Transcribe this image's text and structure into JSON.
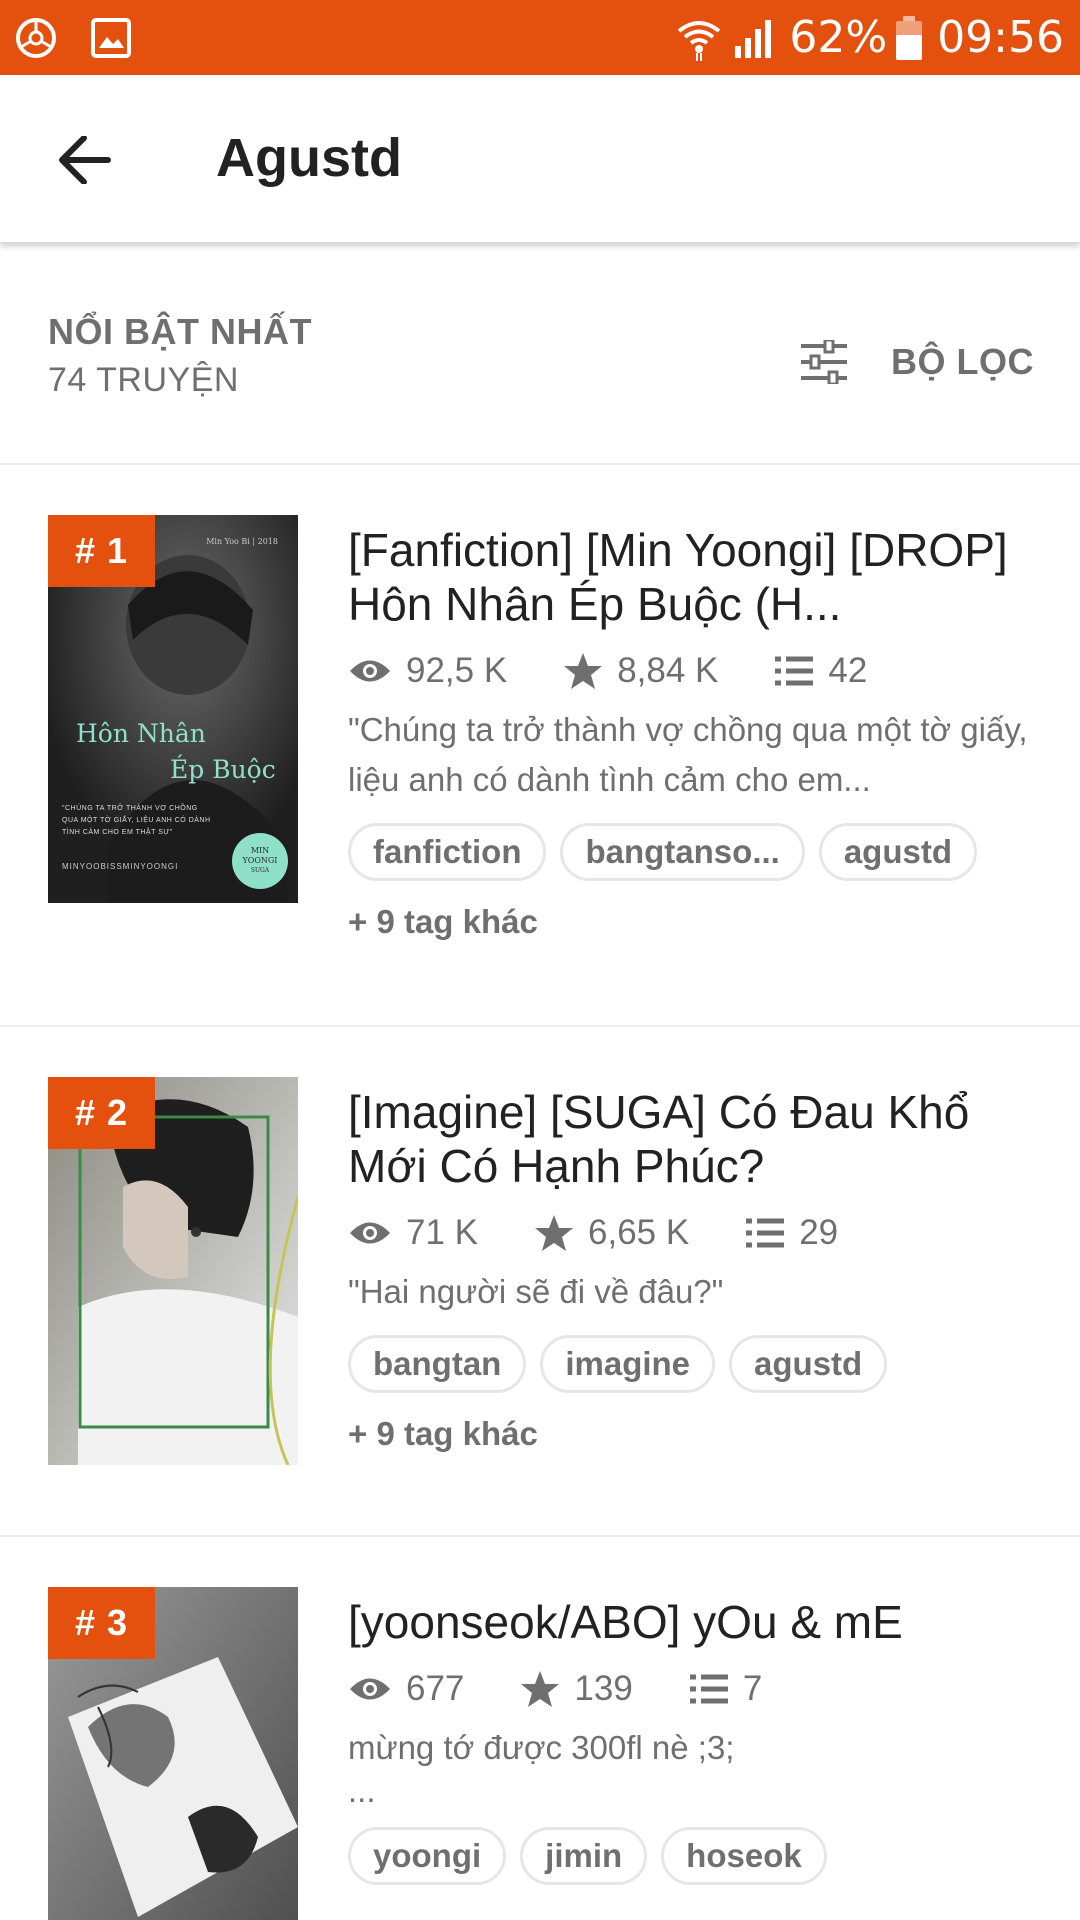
{
  "status_bar": {
    "battery": "62%",
    "time": "09:56"
  },
  "header": {
    "title": "Agustd"
  },
  "section": {
    "sort_label": "NỔI BẬT NHẤT",
    "count_label": "74 TRUYỆN",
    "filter_label": "BỘ LỌC"
  },
  "stories": [
    {
      "rank": "# 1",
      "title": "[Fanfiction] [Min Yoongi] [DROP] Hôn Nhân Ép Buộc (H...",
      "views": "92,5 K",
      "votes": "8,84 K",
      "parts": "42",
      "description": "\"Chúng ta trở thành vợ chồng qua một tờ giấy, liệu anh có dành tình cảm cho em...",
      "tags": [
        "fanfiction",
        "bangtanso...",
        "agustd"
      ],
      "more_tags": "+ 9 tag khác",
      "cover": {
        "bg": "#2a2a2a",
        "title_line1": "Hôn Nhân",
        "title_line2": "Ép Buộc",
        "top_text": "Min Yoo Bi  |  2018",
        "body_text": "\"CHÚNG TA TRỞ THÀNH VỢ CHỒNG QUA MỘT TỜ GIẤY, LIỆU ANH CÓ DÀNH TÌNH CẢM CHO EM THẬT SỰ\"",
        "bottom_text": "MINYOOBISSMINYOONGI",
        "badge_line1": "MIN",
        "badge_line2": "YOONGI",
        "badge_line3": "SUGA"
      }
    },
    {
      "rank": "# 2",
      "title": "[Imagine] [SUGA] Có Đau Khổ Mới Có Hạnh Phúc?",
      "views": "71 K",
      "votes": "6,65 K",
      "parts": "29",
      "description": "\"Hai người sẽ đi về đâu?\"",
      "tags": [
        "bangtan",
        "imagine",
        "agustd"
      ],
      "more_tags": "+ 9 tag khác",
      "cover": {
        "bg": "#d9d9d9"
      }
    },
    {
      "rank": "# 3",
      "title": "[yoonseok/ABO] yOu & mE",
      "views": "677",
      "votes": "139",
      "parts": "7",
      "description": "mừng tớ được 300fl nè ;3;",
      "description2": "...",
      "tags": [
        "yoongi",
        "jimin",
        "hoseok"
      ],
      "cover": {
        "bg": "#8a8a8a"
      }
    }
  ],
  "colors": {
    "accent": "#e4500e",
    "muted_text": "#6f6f6f"
  },
  "icons": [
    "wattpad-icon",
    "gallery-icon",
    "wifi-icon",
    "signal-icon",
    "battery-icon",
    "back-arrow-icon",
    "filter-sliders-icon",
    "eye-icon",
    "star-icon",
    "list-icon"
  ]
}
